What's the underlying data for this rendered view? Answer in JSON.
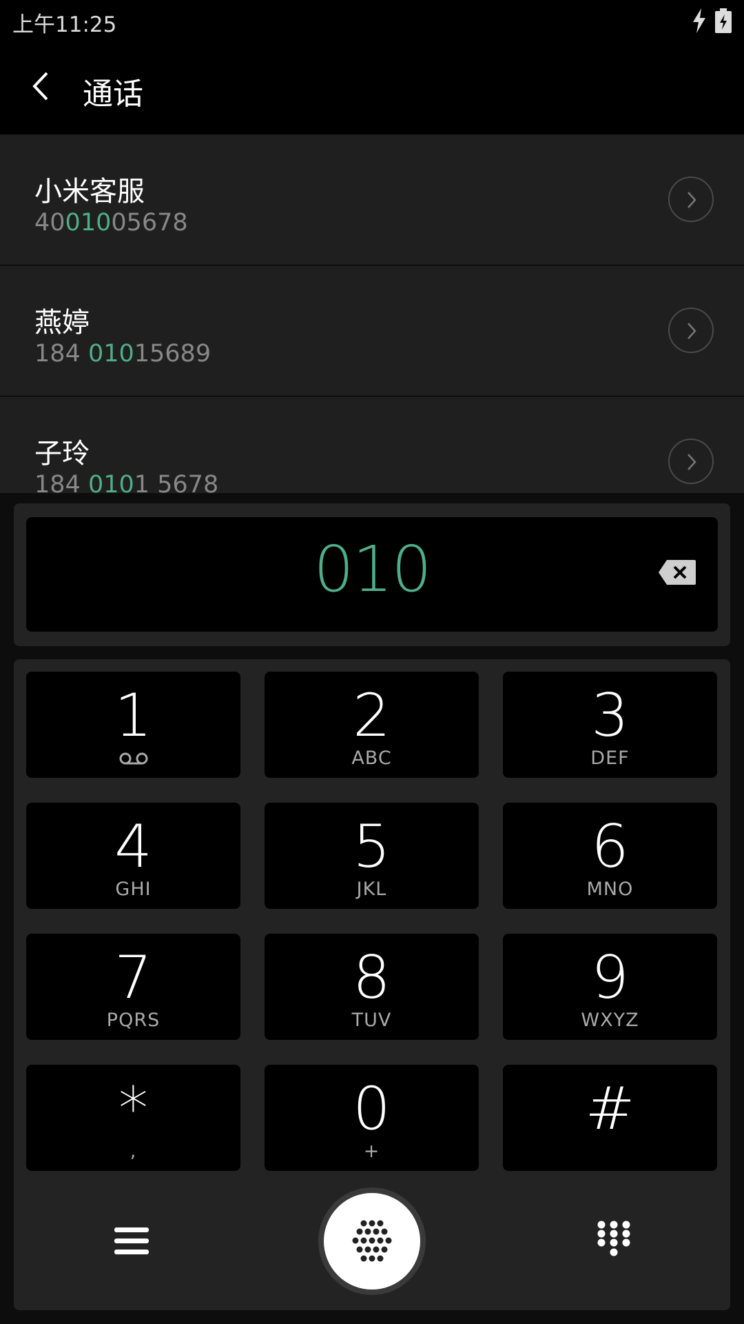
{
  "status_bar": {
    "time": "上午11:25",
    "icons": [
      "charging-bolt-icon",
      "battery-icon"
    ]
  },
  "header": {
    "title": "通话",
    "back_icon": "back-arrow-icon"
  },
  "contacts": [
    {
      "name": "小米客服",
      "number_pre": "40",
      "number_match": "010",
      "number_post": "05678"
    },
    {
      "name": "燕婷",
      "number_pre": "184 ",
      "number_match": "010",
      "number_post": "15689"
    },
    {
      "name": "子玲",
      "number_pre": "184 ",
      "number_match": "010",
      "number_post": "1 5678"
    }
  ],
  "dialer": {
    "dialed_number": "010",
    "keys": [
      {
        "digit": "1",
        "sub": ""
      },
      {
        "digit": "2",
        "sub": "ABC"
      },
      {
        "digit": "3",
        "sub": "DEF"
      },
      {
        "digit": "4",
        "sub": "GHI"
      },
      {
        "digit": "5",
        "sub": "JKL"
      },
      {
        "digit": "6",
        "sub": "MNO"
      },
      {
        "digit": "7",
        "sub": "PQRS"
      },
      {
        "digit": "8",
        "sub": "TUV"
      },
      {
        "digit": "9",
        "sub": "WXYZ"
      },
      {
        "digit": "*",
        "sub": ","
      },
      {
        "digit": "0",
        "sub": "+"
      },
      {
        "digit": "#",
        "sub": ""
      }
    ]
  },
  "colors": {
    "accent": "#4fae8a",
    "panel": "#232323",
    "list_bg": "#1f1f1f"
  }
}
